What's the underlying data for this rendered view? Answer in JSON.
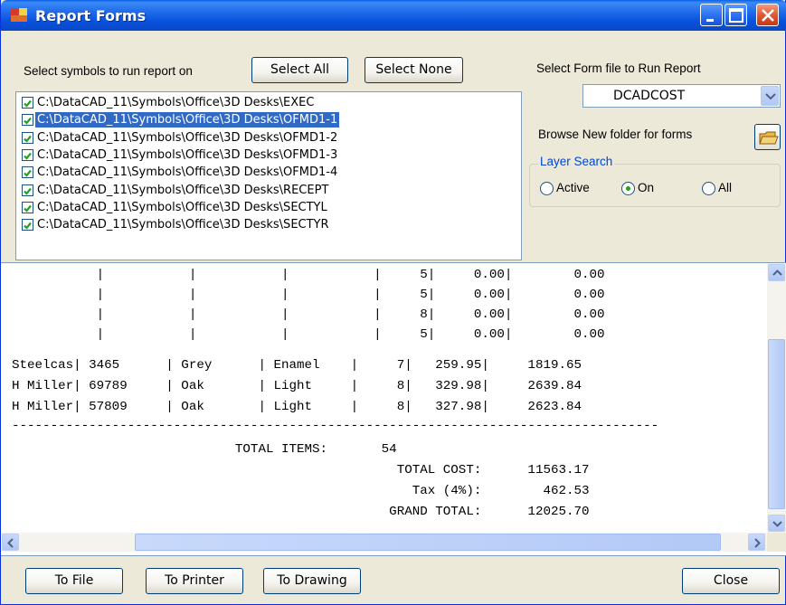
{
  "window": {
    "title": "Report Forms"
  },
  "symbols": {
    "prompt": "Select symbols to run report on",
    "select_all_label": "Select All",
    "select_none_label": "Select None",
    "items": [
      {
        "path": "C:\\DataCAD_11\\Symbols\\Office\\3D Desks\\EXEC",
        "checked": true,
        "selected": false
      },
      {
        "path": "C:\\DataCAD_11\\Symbols\\Office\\3D Desks\\OFMD1-1",
        "checked": true,
        "selected": true
      },
      {
        "path": "C:\\DataCAD_11\\Symbols\\Office\\3D Desks\\OFMD1-2",
        "checked": true,
        "selected": false
      },
      {
        "path": "C:\\DataCAD_11\\Symbols\\Office\\3D Desks\\OFMD1-3",
        "checked": true,
        "selected": false
      },
      {
        "path": "C:\\DataCAD_11\\Symbols\\Office\\3D Desks\\OFMD1-4",
        "checked": true,
        "selected": false
      },
      {
        "path": "C:\\DataCAD_11\\Symbols\\Office\\3D Desks\\RECEPT",
        "checked": true,
        "selected": false
      },
      {
        "path": "C:\\DataCAD_11\\Symbols\\Office\\3D Desks\\SECTYL",
        "checked": true,
        "selected": false
      },
      {
        "path": "C:\\DataCAD_11\\Symbols\\Office\\3D Desks\\SECTYR",
        "checked": true,
        "selected": false
      }
    ]
  },
  "form": {
    "prompt": "Select Form file to Run Report",
    "selected_form": "DCADCOST",
    "browse_label": "Browse New folder for forms"
  },
  "layer_search": {
    "title": "Layer Search",
    "options": [
      {
        "label": "Active",
        "checked": false
      },
      {
        "label": "On",
        "checked": true
      },
      {
        "label": "All",
        "checked": false
      }
    ]
  },
  "report": {
    "lines": [
      "           |           |           |           |     5|     0.00|        0.00",
      "           |           |           |           |     5|     0.00|        0.00",
      "           |           |           |           |     8|     0.00|        0.00",
      "           |           |           |           |     5|     0.00|        0.00",
      "Steelcas| 3465      | Grey      | Enamel    |     7|   259.95|     1819.65",
      "H Miller| 69789     | Oak       | Light     |     8|   329.98|     2639.84",
      "H Miller| 57809     | Oak       | Light     |     8|   327.98|     2623.84",
      "------------------------------------------------------------------------------------",
      "                             TOTAL ITEMS:       54",
      "                                                  TOTAL COST:      11563.17",
      "                                                    Tax (4%):        462.53",
      "                                                 GRAND TOTAL:      12025.70"
    ]
  },
  "actions": {
    "to_file": "To File",
    "to_printer": "To Printer",
    "to_drawing": "To Drawing",
    "close": "Close"
  },
  "colors": {
    "titlebar": "#0852dd",
    "selection": "#316ac5",
    "group_title": "#0046d5",
    "check": "#21a121"
  }
}
